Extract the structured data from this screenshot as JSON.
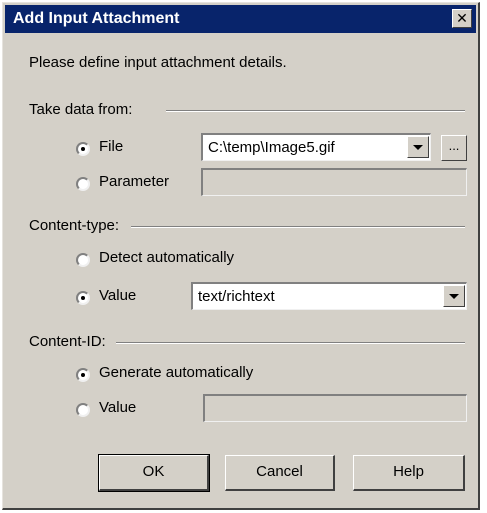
{
  "window": {
    "title": "Add Input Attachment",
    "close_glyph": "✕"
  },
  "intro": "Please define input attachment details.",
  "take_data": {
    "label": "Take data from:",
    "file_label": "File",
    "file_value": "C:\\temp\\Image5.gif",
    "browse_label": "...",
    "parameter_label": "Parameter",
    "parameter_value": "",
    "selected": "File"
  },
  "content_type": {
    "label": "Content-type:",
    "detect_label": "Detect automatically",
    "value_label": "Value",
    "value": "text/richtext",
    "selected": "Value"
  },
  "content_id": {
    "label": "Content-ID:",
    "generate_label": "Generate automatically",
    "value_label": "Value",
    "value": "",
    "selected": "Generate automatically"
  },
  "buttons": {
    "ok": "OK",
    "cancel": "Cancel",
    "help": "Help"
  }
}
